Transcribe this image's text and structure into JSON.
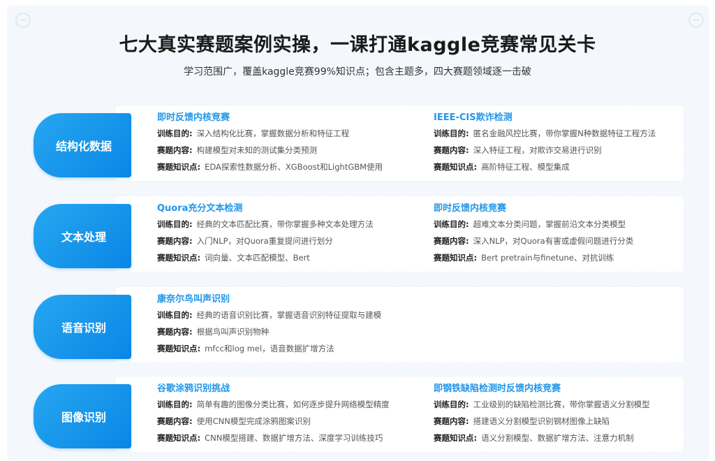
{
  "header": {
    "title": "七大真实赛题案例实操，一课打通kaggle竞赛常见关卡",
    "subtitle": "学习范围广，覆盖kaggle竞赛99%知识点；包含主题多，四大赛题领域逐一击破"
  },
  "labels": {
    "goal": "训练目的:",
    "content": "赛题内容:",
    "knowledge": "赛题知识点:"
  },
  "sections": [
    {
      "name": "结构化数据",
      "cases": [
        {
          "title": "即时反馈内核竞赛",
          "goal": "深入结构化比赛，掌握数据分析和特征工程",
          "content": "构建模型对未知的测试集分类预测",
          "knowledge": "EDA探索性数据分析、XGBoost和LightGBM使用"
        },
        {
          "title": "IEEE-CIS欺诈检测",
          "goal": "匿名金融风控比赛，带你掌握N种数据特征工程方法",
          "content": "深入特征工程，对欺诈交易进行识别",
          "knowledge": "高阶特征工程、模型集成"
        }
      ]
    },
    {
      "name": "文本处理",
      "cases": [
        {
          "title": "Quora充分文本检测",
          "goal": "经典的文本匹配比赛，带你掌握多种文本处理方法",
          "content": "入门NLP，对Quora重复提问进行划分",
          "knowledge": "词向量、文本匹配模型、Bert"
        },
        {
          "title": "即时反馈内核竞赛",
          "goal": "超难文本分类问题，掌握前沿文本分类模型",
          "content": "深入NLP，对Quora有害或虚假问题进行分类",
          "knowledge": "Bert pretrain与finetune、对抗训练"
        }
      ]
    },
    {
      "name": "语音识别",
      "cases": [
        {
          "title": "康奈尔鸟叫声识别",
          "goal": "经典的语音识别比赛，掌握语音识别特征提取与建模",
          "content": "根据鸟叫声识别物种",
          "knowledge": "mfcc和log mel，语音数据扩增方法"
        }
      ]
    },
    {
      "name": "图像识别",
      "cases": [
        {
          "title": "谷歌涂鸦识别挑战",
          "goal": "简单有趣的图像分类比赛，如何逐步提升网络模型精度",
          "content": "使用CNN模型完成涂鸦图案识别",
          "knowledge": "CNN模型搭建、数据扩增方法、深度学习训练技巧"
        },
        {
          "title": "即钢铁缺陷检测时反馈内核竞赛",
          "goal": "工业级别的缺陷检测比赛，带你掌握语义分割模型",
          "content": "搭建语义分割模型识别钢材图像上缺陷",
          "knowledge": "语义分割模型、数据扩增方法、注意力机制"
        }
      ]
    }
  ]
}
